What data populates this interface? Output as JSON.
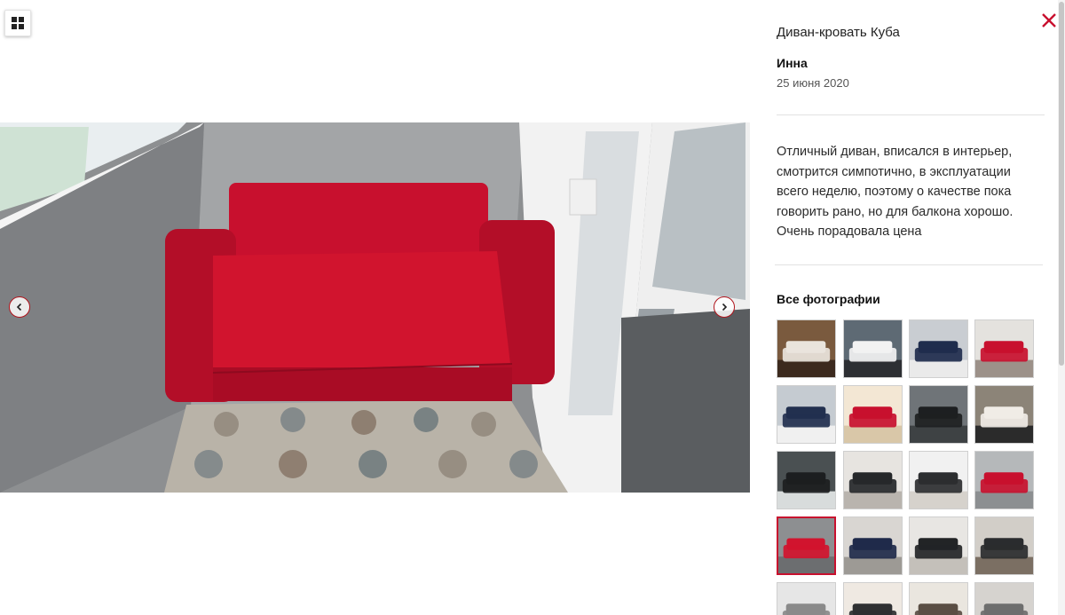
{
  "product": {
    "title": "Диван-кровать Куба"
  },
  "review": {
    "author": "Инна",
    "date": "25 июня 2020",
    "text": "Отличный диван, вписался в интерьер, смотрится симпотично, в эксплуатации всего неделю, поэтому о качестве пока говорить рано, но для балкона хорошо. Очень порадовала цена"
  },
  "gallery": {
    "heading": "Все фотографии",
    "active_index": 12,
    "thumbs": [
      {
        "scene": "dining-room"
      },
      {
        "scene": "white-chairs"
      },
      {
        "scene": "navy-sofa"
      },
      {
        "scene": "red-sofa-open"
      },
      {
        "scene": "navy-sofa-pillows"
      },
      {
        "scene": "red-sofa-lamp"
      },
      {
        "scene": "black-sofa"
      },
      {
        "scene": "plaid-sofa"
      },
      {
        "scene": "dark-sofa-table"
      },
      {
        "scene": "black-sofa-brick"
      },
      {
        "scene": "black-sofa-white-wall"
      },
      {
        "scene": "red-sofa-grey"
      },
      {
        "scene": "red-sofa-balcony"
      },
      {
        "scene": "navy-sofa-brick"
      },
      {
        "scene": "black-sofa-room"
      },
      {
        "scene": "dark-sofa-window"
      },
      {
        "scene": "grey-corner"
      },
      {
        "scene": "people-sofa"
      },
      {
        "scene": "people-room"
      },
      {
        "scene": "grey-sofa"
      }
    ]
  },
  "icons": {
    "grid": "grid-icon",
    "close": "close-icon",
    "prev": "chevron-left-icon",
    "next": "chevron-right-icon"
  },
  "colors": {
    "accent": "#c8102e",
    "sofa": "#d1142e"
  }
}
